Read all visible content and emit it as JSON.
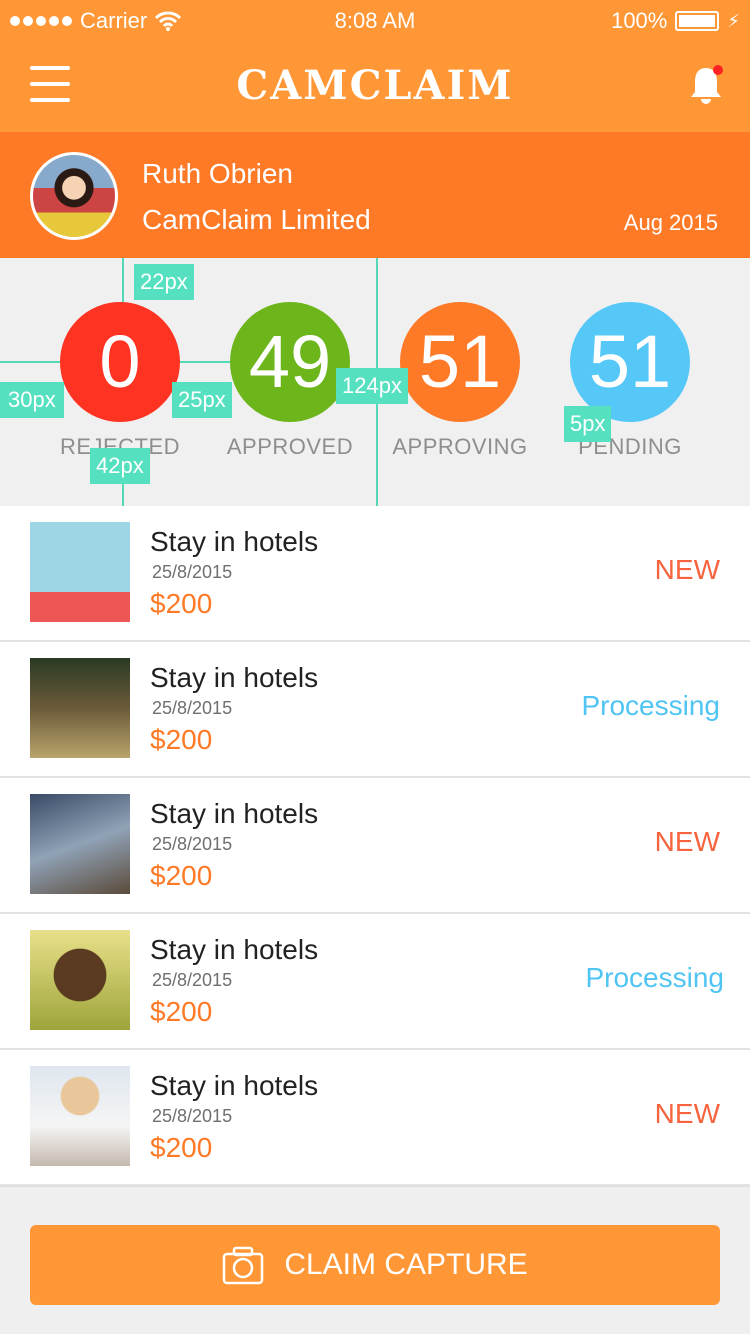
{
  "status_bar": {
    "carrier": "Carrier",
    "time": "8:08 AM",
    "battery": "100%"
  },
  "nav": {
    "title": "CAMCLAIM"
  },
  "profile": {
    "name": "Ruth Obrien",
    "company": "CamClaim Limited",
    "date": "Aug 2015"
  },
  "stats": [
    {
      "value": "0",
      "label": "REJECTED",
      "color": "#ff3322"
    },
    {
      "value": "49",
      "label": "APPROVED",
      "color": "#6cb51a"
    },
    {
      "value": "51",
      "label": "APPROVING",
      "color": "#ff7a27"
    },
    {
      "value": "51",
      "label": "PENDING",
      "color": "#56c8f8"
    }
  ],
  "spec_tags": [
    "22px",
    "30px",
    "25px",
    "124px",
    "42px",
    "5px"
  ],
  "claims": [
    {
      "title": "Stay in hotels",
      "date": "25/8/2015",
      "amount": "$200",
      "status": "NEW"
    },
    {
      "title": "Stay in hotels",
      "date": "25/8/2015",
      "amount": "$200",
      "status": "Processing"
    },
    {
      "title": "Stay in hotels",
      "date": "25/8/2015",
      "amount": "$200",
      "status": "NEW"
    },
    {
      "title": "Stay in hotels",
      "date": "25/8/2015",
      "amount": "$200",
      "status": "Processing"
    },
    {
      "title": "Stay in hotels",
      "date": "25/8/2015",
      "amount": "$200",
      "status": "NEW"
    }
  ],
  "bottom": {
    "button_label": "CLAIM CAPTURE"
  },
  "colors": {
    "header": "#ff9736",
    "profile_bar": "#ff7a27",
    "new": "#f5643f",
    "processing": "#50c4f2",
    "amount": "#ff7a27"
  }
}
